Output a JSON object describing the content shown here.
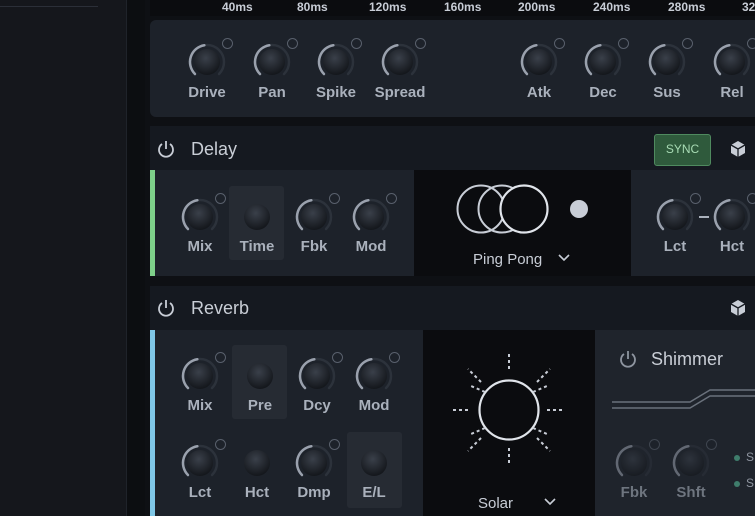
{
  "timeline": {
    "ticks": [
      "40ms",
      "80ms",
      "120ms",
      "160ms",
      "200ms",
      "240ms",
      "280ms",
      "32"
    ]
  },
  "envelope": {
    "knobs": [
      {
        "label": "Drive"
      },
      {
        "label": "Pan"
      },
      {
        "label": "Spike"
      },
      {
        "label": "Spread"
      },
      {
        "label": "Atk"
      },
      {
        "label": "Dec"
      },
      {
        "label": "Sus"
      },
      {
        "label": "Rel"
      }
    ]
  },
  "delay": {
    "title": "Delay",
    "sync_label": "SYNC",
    "accent": "#7ed08a",
    "knobs": [
      {
        "label": "Mix"
      },
      {
        "label": "Time"
      },
      {
        "label": "Fbk"
      },
      {
        "label": "Mod"
      }
    ],
    "mode": "Ping Pong",
    "filter_knobs": [
      {
        "label": "Lct"
      },
      {
        "label": "Hct"
      }
    ]
  },
  "reverb": {
    "title": "Reverb",
    "accent": "#7fc7e6",
    "knobs_row1": [
      {
        "label": "Mix"
      },
      {
        "label": "Pre"
      },
      {
        "label": "Dcy"
      },
      {
        "label": "Mod"
      }
    ],
    "knobs_row2": [
      {
        "label": "Lct"
      },
      {
        "label": "Hct"
      },
      {
        "label": "Dmp"
      },
      {
        "label": "E/L"
      }
    ],
    "mode": "Solar",
    "shimmer": {
      "title": "Shimmer",
      "knobs": [
        {
          "label": "Fbk"
        },
        {
          "label": "Shft"
        }
      ],
      "options": [
        "S",
        "S"
      ]
    }
  }
}
